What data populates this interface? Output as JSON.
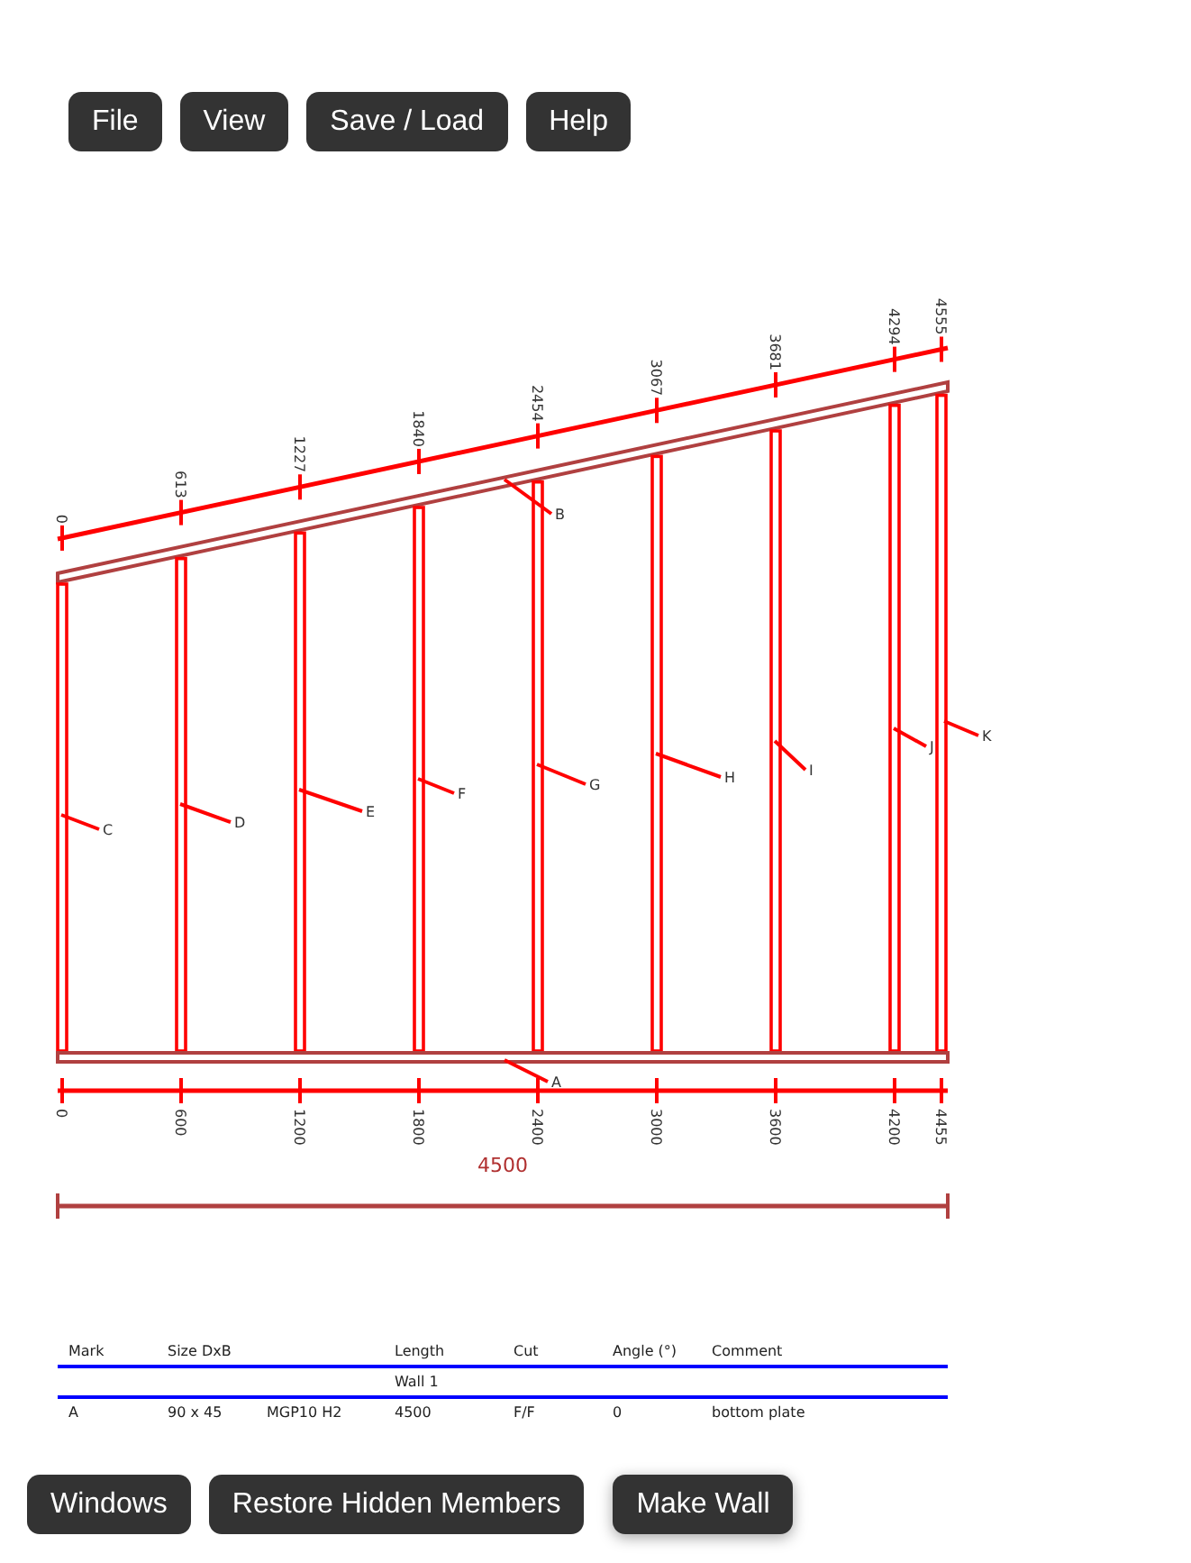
{
  "menu": [
    "File",
    "View",
    "Save / Load",
    "Help"
  ],
  "drawing": {
    "top_ticks": [
      "0",
      "613",
      "1227",
      "1840",
      "2454",
      "3067",
      "3681",
      "4294",
      "4555"
    ],
    "bottom_ticks": [
      "0",
      "600",
      "1200",
      "1800",
      "2400",
      "3000",
      "3600",
      "4200",
      "4455"
    ],
    "total_length": "4500",
    "marks": [
      "A",
      "B",
      "C",
      "D",
      "E",
      "F",
      "G",
      "H",
      "I",
      "J",
      "K"
    ]
  },
  "table": {
    "columns": [
      "Mark",
      "Size DxB",
      "",
      "Length",
      "Cut",
      "Angle (°)",
      "Comment"
    ],
    "group": "Wall 1",
    "rows": [
      [
        "A",
        "90 x 45",
        "MGP10 H2",
        "4500",
        "F/F",
        "0",
        "bottom plate"
      ]
    ]
  },
  "bottom_buttons": [
    "Windows",
    "Restore Hidden Members",
    "Make Wall"
  ]
}
